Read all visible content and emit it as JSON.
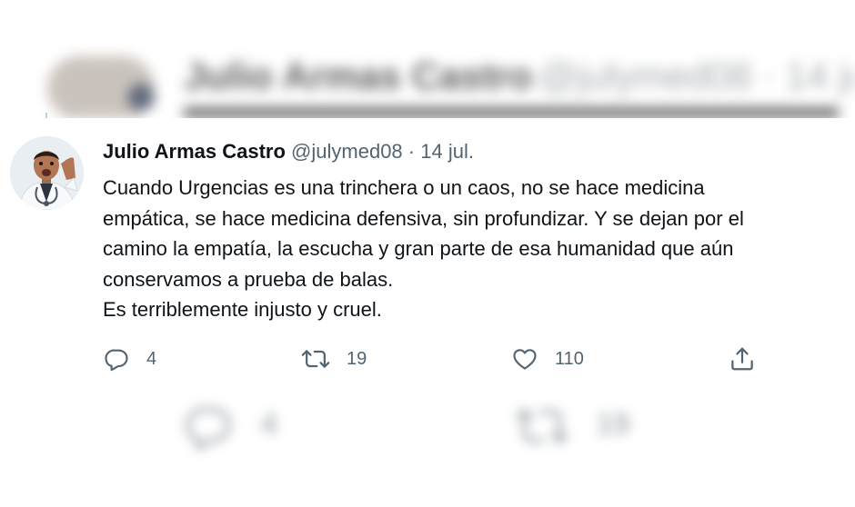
{
  "background_tweet": {
    "name": "Julio Armas Castro",
    "handle_date": "@julymed08 · 14 jul."
  },
  "tweet": {
    "author_name": "Julio Armas Castro",
    "handle": "@julymed08",
    "separator": "·",
    "date": "14 jul.",
    "text_lines": [
      "Cuando Urgencias es una trinchera o un caos, no se hace medicina",
      "empática, se hace medicina defensiva, sin profundizar. Y se dejan por el",
      "camino la empatía, la escucha y gran parte de esa humanidad que aún",
      "conservamos a prueba de balas.",
      "Es terriblemente injusto y cruel."
    ],
    "avatar_icon": "profile-photo"
  },
  "actions": {
    "reply": {
      "icon": "reply-icon",
      "count": "4"
    },
    "retweet": {
      "icon": "retweet-icon",
      "count": "19"
    },
    "like": {
      "icon": "heart-icon",
      "count": "110"
    },
    "share": {
      "icon": "share-icon"
    }
  },
  "background_actions": {
    "reply_count": "4",
    "retweet_count": "19"
  },
  "colors": {
    "text_primary": "#0f1419",
    "text_secondary": "#536471",
    "background": "#ffffff"
  }
}
